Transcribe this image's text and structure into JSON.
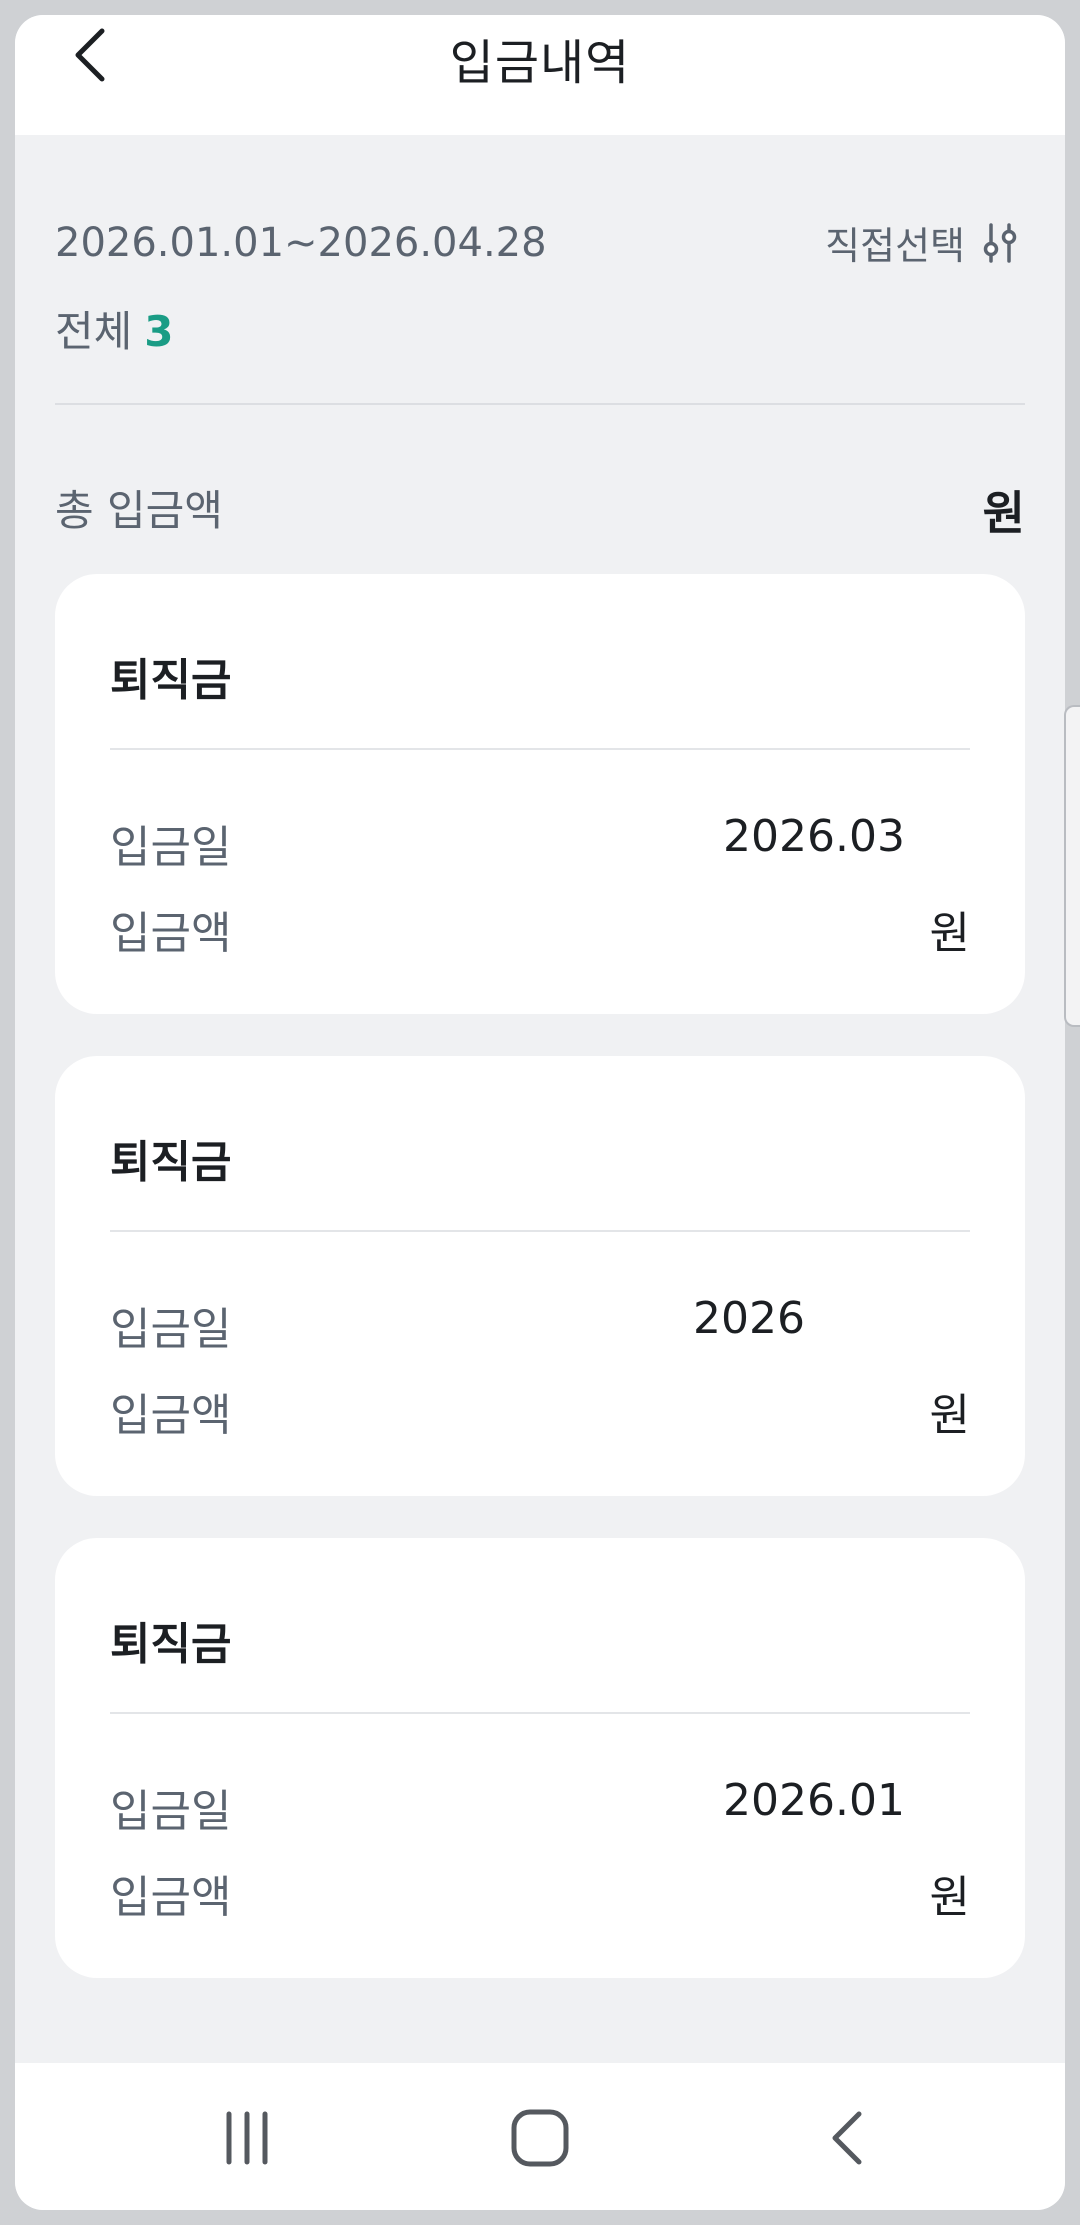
{
  "header": {
    "title": "입금내역"
  },
  "filter": {
    "date_range": "2026.01.01~2026.04.28",
    "select_label": "직접선택",
    "total_label": "전체",
    "total_count": "3"
  },
  "summary": {
    "label": "총 입금액",
    "value": "원"
  },
  "cards": [
    {
      "title": "퇴직금",
      "date_label": "입금일",
      "date_value": "2026.03",
      "amount_label": "입금액",
      "amount_value": "원"
    },
    {
      "title": "퇴직금",
      "date_label": "입금일",
      "date_value": "2026",
      "amount_label": "입금액",
      "amount_value": "원"
    },
    {
      "title": "퇴직금",
      "date_label": "입금일",
      "date_value": "2026.01",
      "amount_label": "입금액",
      "amount_value": "원"
    }
  ],
  "colors": {
    "accent": "#1a9c85",
    "muted_text": "#5b6470",
    "background": "#f0f1f3"
  },
  "icons": {
    "back": "chevron-left-icon",
    "filter": "sliders-icon",
    "recent_apps": "recent-apps-icon",
    "home": "home-icon",
    "nav_back": "nav-back-icon"
  }
}
